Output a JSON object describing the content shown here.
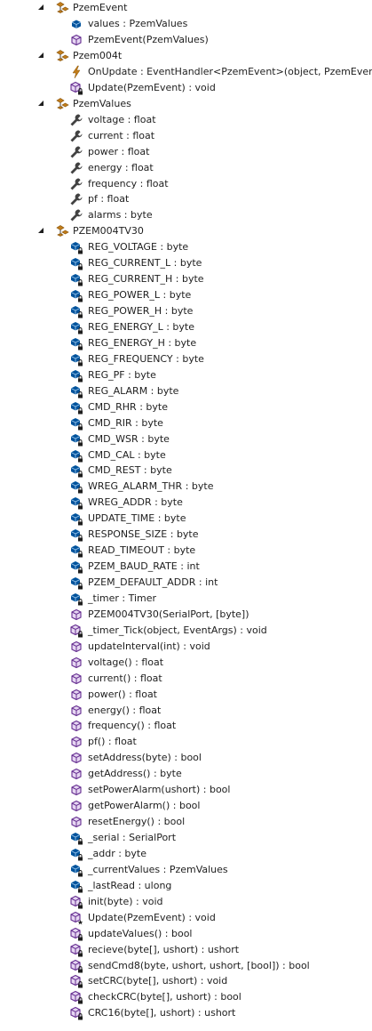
{
  "tree": [
    {
      "name": "PzemEvent",
      "expanded": true,
      "members": [
        {
          "label": "values : PzemValues",
          "icon": "field-icon"
        },
        {
          "label": "PzemEvent(PzemValues)",
          "icon": "method-icon"
        }
      ]
    },
    {
      "name": "Pzem004t",
      "expanded": true,
      "members": [
        {
          "label": "OnUpdate : EventHandler<PzemEvent>(object, PzemEvent)",
          "icon": "event-icon"
        },
        {
          "label": "Update(PzemEvent) : void",
          "icon": "private-method-icon"
        }
      ]
    },
    {
      "name": "PzemValues",
      "expanded": true,
      "members": [
        {
          "label": "voltage : float",
          "icon": "property-icon"
        },
        {
          "label": "current : float",
          "icon": "property-icon"
        },
        {
          "label": "power : float",
          "icon": "property-icon"
        },
        {
          "label": "energy : float",
          "icon": "property-icon"
        },
        {
          "label": "frequency : float",
          "icon": "property-icon"
        },
        {
          "label": "pf : float",
          "icon": "property-icon"
        },
        {
          "label": "alarms : byte",
          "icon": "property-icon"
        }
      ]
    },
    {
      "name": "PZEM004TV30",
      "expanded": true,
      "members": [
        {
          "label": "REG_VOLTAGE : byte",
          "icon": "private-field-icon"
        },
        {
          "label": "REG_CURRENT_L : byte",
          "icon": "private-field-icon"
        },
        {
          "label": "REG_CURRENT_H : byte",
          "icon": "private-field-icon"
        },
        {
          "label": "REG_POWER_L : byte",
          "icon": "private-field-icon"
        },
        {
          "label": "REG_POWER_H : byte",
          "icon": "private-field-icon"
        },
        {
          "label": "REG_ENERGY_L : byte",
          "icon": "private-field-icon"
        },
        {
          "label": "REG_ENERGY_H : byte",
          "icon": "private-field-icon"
        },
        {
          "label": "REG_FREQUENCY : byte",
          "icon": "private-field-icon"
        },
        {
          "label": "REG_PF : byte",
          "icon": "private-field-icon"
        },
        {
          "label": "REG_ALARM : byte",
          "icon": "private-field-icon"
        },
        {
          "label": "CMD_RHR : byte",
          "icon": "private-field-icon"
        },
        {
          "label": "CMD_RIR : byte",
          "icon": "private-field-icon"
        },
        {
          "label": "CMD_WSR : byte",
          "icon": "private-field-icon"
        },
        {
          "label": "CMD_CAL : byte",
          "icon": "private-field-icon"
        },
        {
          "label": "CMD_REST : byte",
          "icon": "private-field-icon"
        },
        {
          "label": "WREG_ALARM_THR : byte",
          "icon": "private-field-icon"
        },
        {
          "label": "WREG_ADDR : byte",
          "icon": "private-field-icon"
        },
        {
          "label": "UPDATE_TIME : byte",
          "icon": "private-field-icon"
        },
        {
          "label": "RESPONSE_SIZE : byte",
          "icon": "private-field-icon"
        },
        {
          "label": "READ_TIMEOUT : byte",
          "icon": "private-field-icon"
        },
        {
          "label": "PZEM_BAUD_RATE : int",
          "icon": "private-field-icon"
        },
        {
          "label": "PZEM_DEFAULT_ADDR : int",
          "icon": "private-field-icon"
        },
        {
          "label": "_timer : Timer",
          "icon": "private-field-icon"
        },
        {
          "label": "PZEM004TV30(SerialPort, [byte])",
          "icon": "method-icon"
        },
        {
          "label": "_timer_Tick(object, EventArgs) : void",
          "icon": "private-method-icon"
        },
        {
          "label": "updateInterval(int) : void",
          "icon": "method-icon"
        },
        {
          "label": "voltage() : float",
          "icon": "method-icon"
        },
        {
          "label": "current() : float",
          "icon": "method-icon"
        },
        {
          "label": "power() : float",
          "icon": "method-icon"
        },
        {
          "label": "energy() : float",
          "icon": "method-icon"
        },
        {
          "label": "frequency() : float",
          "icon": "method-icon"
        },
        {
          "label": "pf() : float",
          "icon": "method-icon"
        },
        {
          "label": "setAddress(byte) : bool",
          "icon": "method-icon"
        },
        {
          "label": "getAddress() : byte",
          "icon": "method-icon"
        },
        {
          "label": "setPowerAlarm(ushort) : bool",
          "icon": "method-icon"
        },
        {
          "label": "getPowerAlarm() : bool",
          "icon": "method-icon"
        },
        {
          "label": "resetEnergy() : bool",
          "icon": "method-icon"
        },
        {
          "label": "_serial : SerialPort",
          "icon": "private-field-icon"
        },
        {
          "label": "_addr : byte",
          "icon": "private-field-icon"
        },
        {
          "label": "_currentValues : PzemValues",
          "icon": "private-field-icon"
        },
        {
          "label": "_lastRead : ulong",
          "icon": "private-field-icon"
        },
        {
          "label": "init(byte) : void",
          "icon": "private-method-icon"
        },
        {
          "label": "Update(PzemEvent) : void",
          "icon": "protected-method-icon"
        },
        {
          "label": "updateValues() : bool",
          "icon": "private-method-icon"
        },
        {
          "label": "recieve(byte[], ushort) : ushort",
          "icon": "private-method-icon"
        },
        {
          "label": "sendCmd8(byte, ushort, ushort, [bool]) : bool",
          "icon": "private-method-icon"
        },
        {
          "label": "setCRC(byte[], ushort) : void",
          "icon": "private-method-icon"
        },
        {
          "label": "checkCRC(byte[], ushort) : bool",
          "icon": "private-method-icon"
        },
        {
          "label": "CRC16(byte[], ushort) : ushort",
          "icon": "private-method-icon"
        }
      ]
    }
  ],
  "colors": {
    "class_icon": "#c27d1a",
    "field_icon": "#00539c",
    "method_icon": "#652d90",
    "event_icon": "#c27d1a",
    "property_icon": "#424242",
    "text": "#1e1e1e"
  }
}
